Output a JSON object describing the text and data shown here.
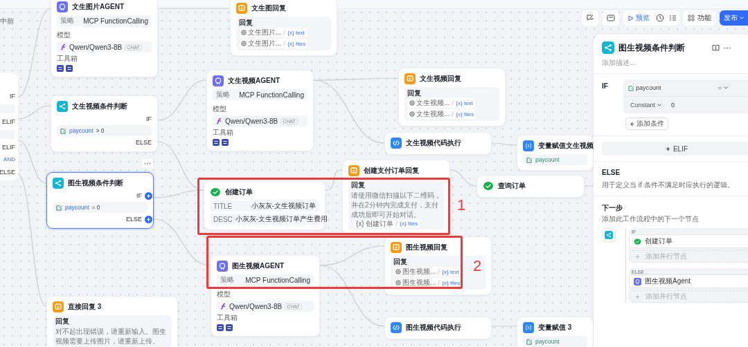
{
  "canvas": {
    "corner_text": "中前",
    "nodes": [
      {
        "kind": "stub",
        "rows": [
          {
            "kind": "port",
            "label": "IF"
          },
          {
            "kind": "blank"
          },
          {
            "kind": "port",
            "label": "ELIF"
          },
          {
            "kind": "blank"
          },
          {
            "kind": "port",
            "label": "ELIF"
          },
          {
            "kind": "logic",
            "label": "AND"
          },
          {
            "kind": "port",
            "label": "ELSE"
          }
        ]
      },
      {
        "kind": "agent",
        "selected": false,
        "title": "文生图片AGENT",
        "strategy_label": "策略",
        "strategy": "MCP FunctionCalling",
        "model_label": "模型",
        "model": "Qwen/Qwen3-8B",
        "model_tag": "CHAT",
        "tools_label": "工具箱"
      },
      {
        "kind": "reply",
        "selected": false,
        "title": "文生图回复",
        "body_label": "回复",
        "refs": [
          {
            "kind": "node",
            "source": "文生图片...",
            "var": "{x} text"
          },
          {
            "kind": "node",
            "source": "文生图片...",
            "var": "{x} files"
          }
        ]
      },
      {
        "kind": "condition",
        "selected": false,
        "title": "文生视频条件判断",
        "rows": [
          {
            "kind": "port",
            "label": "IF"
          },
          {
            "kind": "expr",
            "var": "paycount",
            "op": "> 0"
          },
          {
            "kind": "port",
            "label": "ELSE"
          }
        ]
      },
      {
        "kind": "agent",
        "selected": false,
        "title": "文生视频AGENT",
        "strategy_label": "策略",
        "strategy": "MCP FunctionCalling",
        "model_label": "模型",
        "model": "Qwen/Qwen3-8B",
        "model_tag": "CHAT",
        "tools_label": "工具箱"
      },
      {
        "kind": "reply",
        "selected": false,
        "title": "文生视频回复",
        "body_label": "回复",
        "refs": [
          {
            "kind": "node",
            "source": "文生视频...",
            "var": "{x} text"
          },
          {
            "kind": "node",
            "source": "文生视频...",
            "var": "{x} files"
          }
        ]
      },
      {
        "kind": "code",
        "selected": false,
        "title": "文生视频代码执行"
      },
      {
        "kind": "assign",
        "selected": false,
        "title": "变量赋值文生视频",
        "vars": [
          "paycount"
        ]
      },
      {
        "kind": "condition",
        "selected": true,
        "title": "图生视频条件判断",
        "rows": [
          {
            "kind": "port",
            "label": "IF"
          },
          {
            "kind": "expr",
            "var": "paycount",
            "op": "= 0"
          },
          {
            "kind": "port",
            "label": "ELSE"
          }
        ]
      },
      {
        "kind": "tool",
        "selected": false,
        "title": "创建订单",
        "params": [
          {
            "key": "TITLE",
            "value": "小灰灰-文生视频订单"
          },
          {
            "key": "DESC",
            "value": "小灰灰-文生视频订单产生费用"
          }
        ]
      },
      {
        "kind": "reply",
        "selected": false,
        "title": "创建支付订单回复",
        "body_label": "回复",
        "message": "请使用微信扫描以下二维码，并在2分钟内完成支付，支付成功后即可开始对话。",
        "refs": [
          {
            "kind": "var",
            "source": "{x} 创建订单",
            "var": "{x} files"
          }
        ]
      },
      {
        "kind": "tool",
        "selected": false,
        "title": "查询订单"
      },
      {
        "kind": "agent",
        "selected": false,
        "title": "图生视频AGENT",
        "strategy_label": "策略",
        "strategy": "MCP FunctionCalling",
        "model_label": "模型",
        "model": "Qwen/Qwen3-8B",
        "model_tag": "CHAT",
        "tools_label": "工具箱"
      },
      {
        "kind": "reply",
        "selected": false,
        "title": "图生视频回复",
        "body_label": "回复",
        "refs": [
          {
            "kind": "node",
            "source": "图生视频...",
            "var": "{x} text"
          },
          {
            "kind": "node",
            "source": "图生视频...",
            "var": "{x} files"
          }
        ]
      },
      {
        "kind": "reply",
        "selected": false,
        "title": "直接回复 3",
        "body_label": "回复",
        "message": "对不起出现错误，请重新输入。图生视频需要上传图片，请重新上传。"
      },
      {
        "kind": "code",
        "selected": false,
        "title": "图生视频代码执行"
      },
      {
        "kind": "assign",
        "selected": false,
        "title": "变量赋值 3",
        "vars": [
          "paycount"
        ]
      }
    ],
    "annotations": [
      {
        "label": "1"
      },
      {
        "label": "2"
      }
    ]
  },
  "toolbar": {
    "preview": "预览",
    "features": "功能",
    "publish": "发布"
  },
  "panel": {
    "title": "图生视频条件判断",
    "description_placeholder": "添加描述...",
    "if_label": "IF",
    "condition": {
      "var": "paycount",
      "op": "=",
      "operand_type": "Constant",
      "value": "0"
    },
    "add_condition": "添加条件",
    "elif_button": "ELIF",
    "else_title": "ELSE",
    "else_text": "用于定义当 if 条件不满足时应执行的逻辑。",
    "next_title": "下一步",
    "next_hint": "添加此工作流程中的下一个节点",
    "branches": [
      {
        "label": "IF",
        "node": {
          "kind": "tool",
          "title": "创建订单"
        },
        "add": "添加并行节点"
      },
      {
        "label": "ELSE",
        "node": {
          "kind": "agent",
          "title": "图生视频Agent"
        },
        "add": "添加并行节点"
      }
    ]
  }
}
